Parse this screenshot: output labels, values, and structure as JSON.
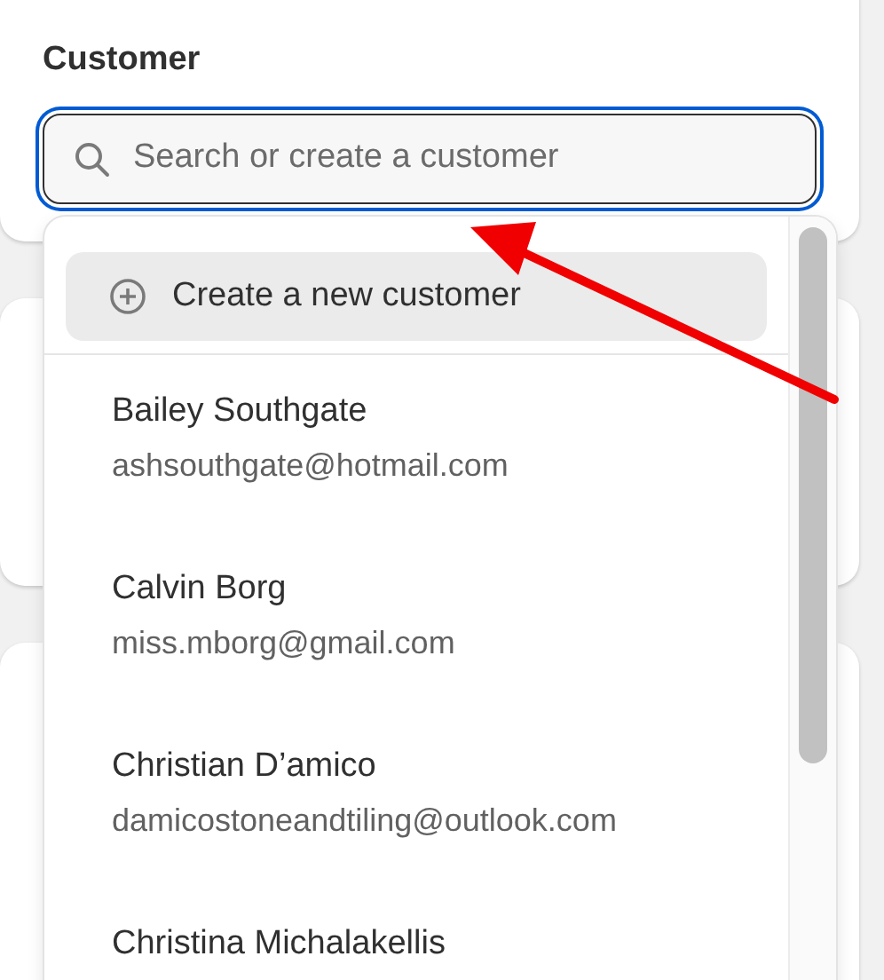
{
  "customer_field": {
    "label": "Customer",
    "placeholder": "Search or create a customer",
    "focused": true
  },
  "dropdown": {
    "create_option": {
      "label": "Create a new customer",
      "highlighted": true
    },
    "customers": [
      {
        "name": "Bailey Southgate",
        "email": "ashsouthgate@hotmail.com"
      },
      {
        "name": "Calvin Borg",
        "email": "miss.mborg@gmail.com"
      },
      {
        "name": "Christian D’amico",
        "email": "damicostoneandtiling@outlook.com"
      },
      {
        "name": "Christina Michalakellis"
      }
    ]
  }
}
